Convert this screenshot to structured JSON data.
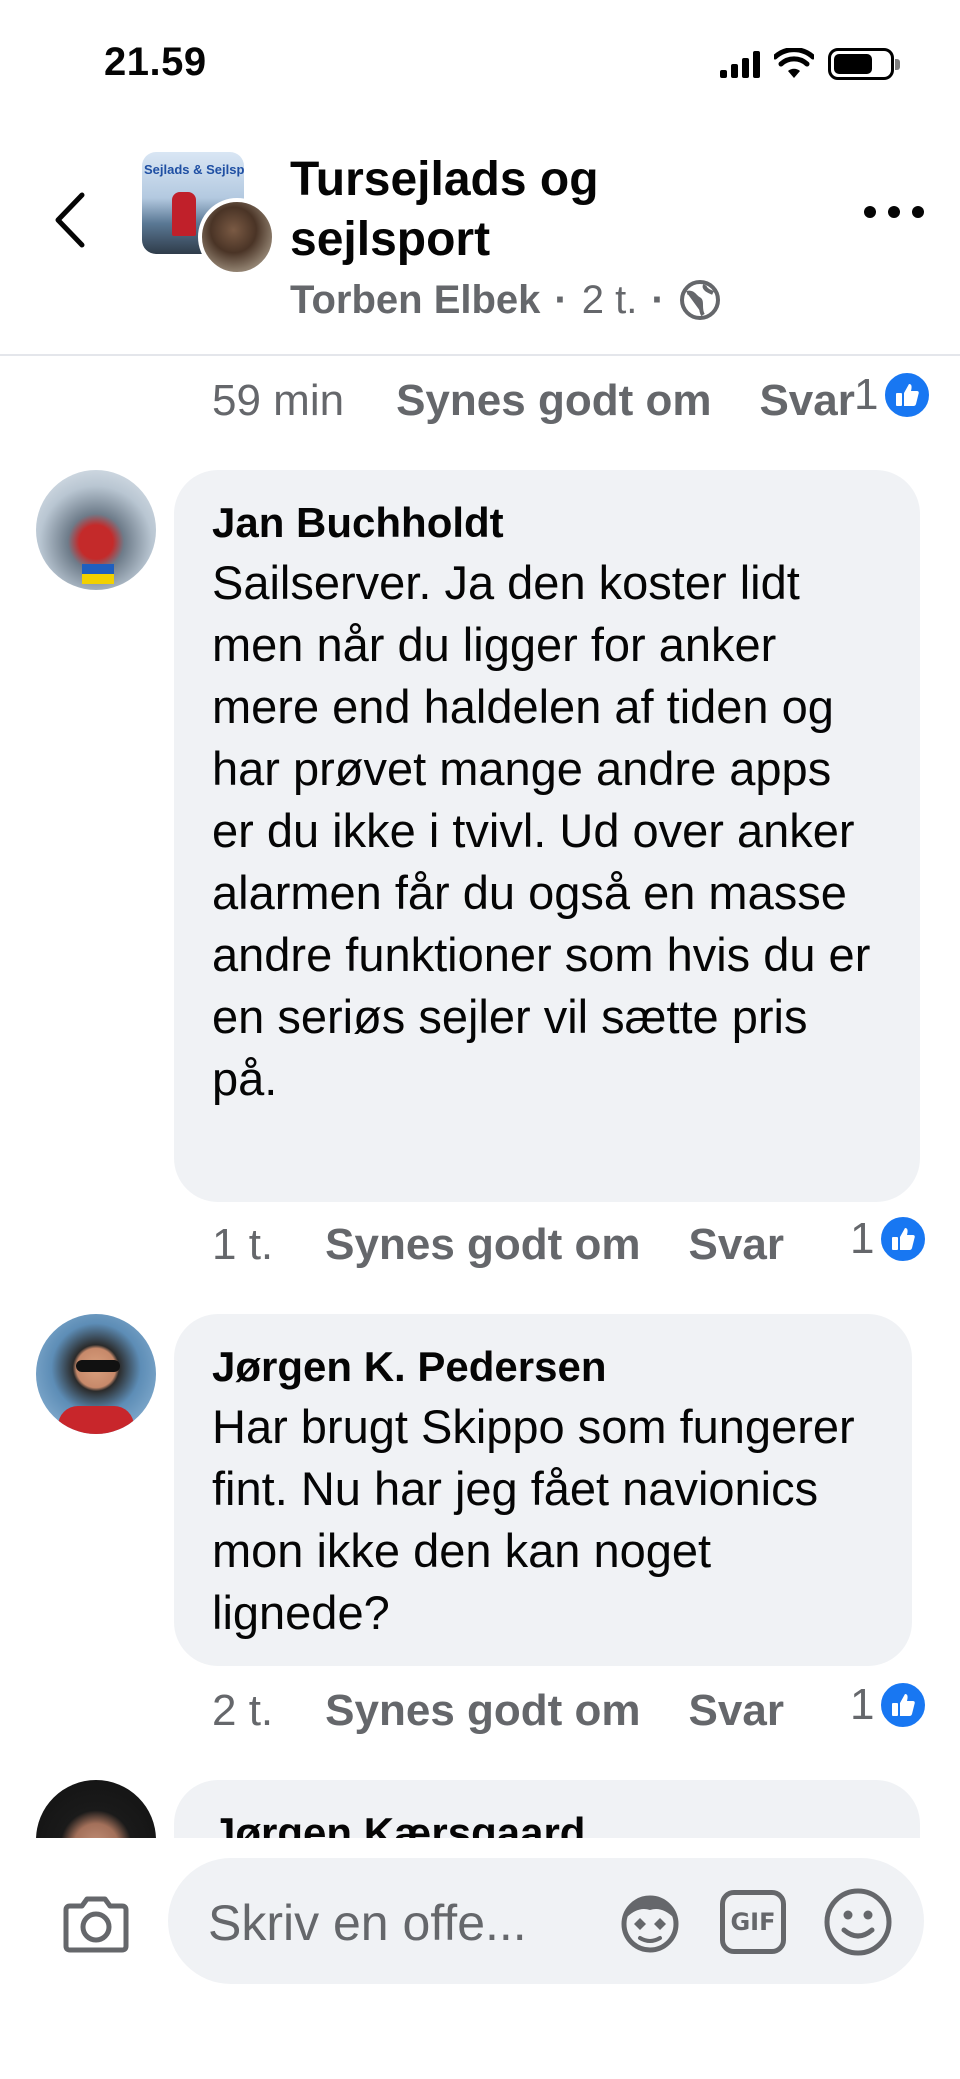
{
  "status_bar": {
    "time": "21.59"
  },
  "header": {
    "group_title": "Tursejlads og sejlsport",
    "author": "Torben Elbek",
    "separator": "·",
    "post_time": "2 t.",
    "avatar_logo_text": "Sejlads & Sejlsport"
  },
  "prev_comment": {
    "time": "59 min",
    "like_label": "Synes godt om",
    "reply_label": "Svar",
    "like_count": "1"
  },
  "comments": [
    {
      "author": "Jan Buchholdt",
      "text": "Sailserver. Ja den koster lidt men når du ligger for anker mere end haldelen af tiden og har prøvet mange andre apps er du ikke i tvivl. Ud over anker alarmen får du også en masse andre funktioner som hvis du er en seriøs sejler vil sætte pris på.",
      "time": "1 t.",
      "like_label": "Synes godt om",
      "reply_label": "Svar",
      "like_count": "1"
    },
    {
      "author": "Jørgen K. Pedersen",
      "text": "Har brugt Skippo som fungerer fint. Nu har jeg fået navionics mon ikke den kan noget lignede?",
      "time": "2 t.",
      "like_label": "Synes godt om",
      "reply_label": "Svar",
      "like_count": "1"
    },
    {
      "author": "Jørgen Kærsgaard"
    }
  ],
  "composer": {
    "placeholder": "Skriv en offe...",
    "gif_label": "GIF"
  },
  "colors": {
    "accent": "#1877f2",
    "muted_text": "#65676b",
    "bubble": "#f0f2f5"
  }
}
